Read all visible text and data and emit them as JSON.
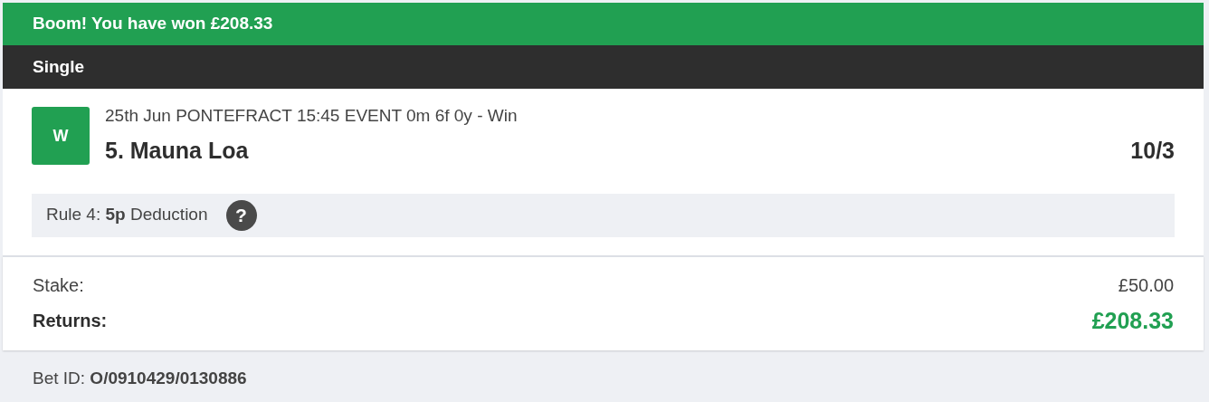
{
  "banner": {
    "kind": "win",
    "text": "Boom! You have won £208.33"
  },
  "bet_type": "Single",
  "selection": {
    "result": "W",
    "kind": "win",
    "event": "25th Jun PONTEFRACT 15:45 EVENT 0m 6f 0y - Win",
    "runner": "5. Mauna Loa",
    "odds": "10/3"
  },
  "rule4": {
    "text": "Rule 4: **5p** Deduction",
    "help": "?"
  },
  "summary": [
    {
      "kind": "plain",
      "label": "Stake:",
      "value": "£50.00"
    },
    {
      "kind": "returns",
      "label": "Returns:",
      "value": "£208.33"
    }
  ],
  "bet_id": "Bet ID: **O/0910429/0130886**"
}
